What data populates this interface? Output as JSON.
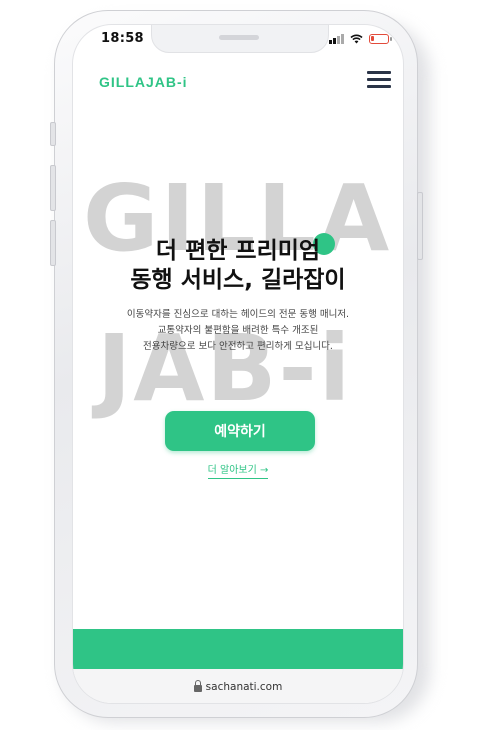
{
  "status_bar": {
    "time": "18:58"
  },
  "header": {
    "logo": "GILLAJAB-i",
    "menu_icon": "hamburger-icon"
  },
  "watermark": {
    "line1": "GILLA",
    "line2": "JAB-i"
  },
  "hero": {
    "title_line1": "더 편한 프리미엄",
    "title_line2": "동행 서비스, 길라잡이",
    "subtitle_line1": "이동약자를 진심으로 대하는 헤이드의 전문 동행 매니저.",
    "subtitle_line2": "교통약자의 불편함을 배려한 특수 개조된",
    "subtitle_line3": "전용차량으로 보다 안전하고 편리하게 모십니다.",
    "cta_label": "예약하기",
    "learn_more_label": "더 알아보기 →"
  },
  "browser": {
    "url": "sachanati.com"
  },
  "colors": {
    "accent": "#2fc486",
    "menu": "#2a3447",
    "watermark": "#d3d3d3"
  }
}
